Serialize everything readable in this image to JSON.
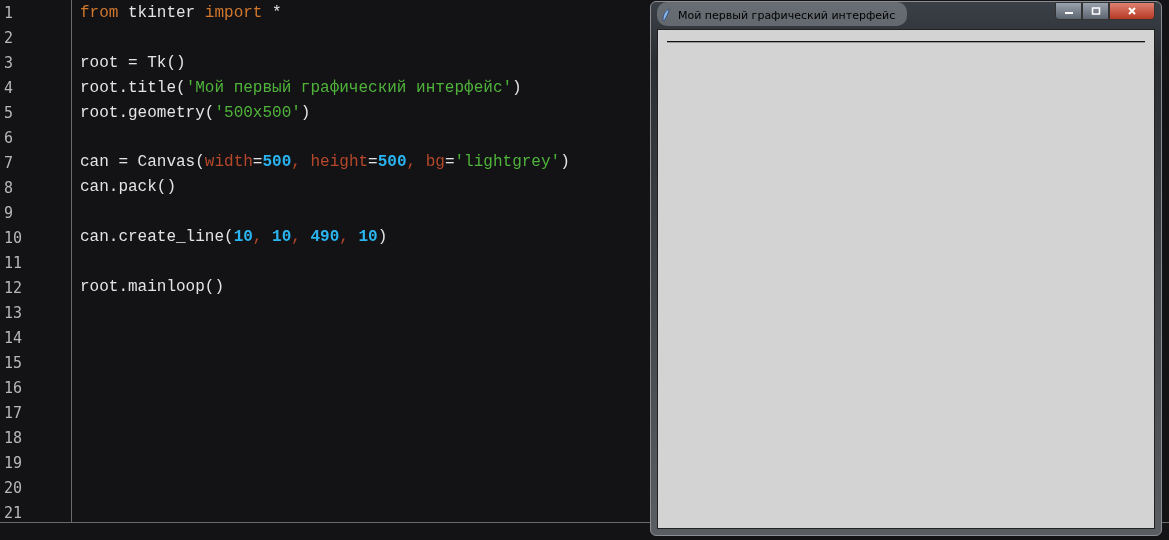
{
  "editor": {
    "lines": [
      {
        "number": "1",
        "tokens": [
          {
            "kind": "keyword",
            "text": "from"
          },
          {
            "kind": "plain",
            "text": " tkinter "
          },
          {
            "kind": "keyword",
            "text": "import"
          },
          {
            "kind": "plain",
            "text": " *"
          }
        ]
      },
      {
        "number": "2"
      },
      {
        "number": "3",
        "tokens": [
          {
            "kind": "plain",
            "text": "root = Tk()"
          }
        ]
      },
      {
        "number": "4",
        "tokens": [
          {
            "kind": "plain",
            "text": "root.title("
          },
          {
            "kind": "string",
            "text": "'Мой первый графический интерфейс'"
          },
          {
            "kind": "plain",
            "text": ")"
          }
        ]
      },
      {
        "number": "5",
        "tokens": [
          {
            "kind": "plain",
            "text": "root.geometry("
          },
          {
            "kind": "string",
            "text": "'500x500'"
          },
          {
            "kind": "plain",
            "text": ")"
          }
        ]
      },
      {
        "number": "6"
      },
      {
        "number": "7",
        "tokens": [
          {
            "kind": "plain",
            "text": "can = Canvas("
          },
          {
            "kind": "param",
            "text": "width"
          },
          {
            "kind": "plain",
            "text": "="
          },
          {
            "kind": "number",
            "text": "500"
          },
          {
            "kind": "param",
            "text": ", height"
          },
          {
            "kind": "plain",
            "text": "="
          },
          {
            "kind": "number",
            "text": "500"
          },
          {
            "kind": "param",
            "text": ", bg"
          },
          {
            "kind": "plain",
            "text": "="
          },
          {
            "kind": "string",
            "text": "'lightgrey'"
          },
          {
            "kind": "plain",
            "text": ")"
          }
        ]
      },
      {
        "number": "8",
        "tokens": [
          {
            "kind": "plain",
            "text": "can.pack()"
          }
        ]
      },
      {
        "number": "9"
      },
      {
        "number": "10",
        "tokens": [
          {
            "kind": "plain",
            "text": "can.create_line("
          },
          {
            "kind": "number",
            "text": "10"
          },
          {
            "kind": "param",
            "text": ", "
          },
          {
            "kind": "number",
            "text": "10"
          },
          {
            "kind": "param",
            "text": ", "
          },
          {
            "kind": "number",
            "text": "490"
          },
          {
            "kind": "param",
            "text": ", "
          },
          {
            "kind": "number",
            "text": "10"
          },
          {
            "kind": "plain",
            "text": ")"
          }
        ]
      },
      {
        "number": "11"
      },
      {
        "number": "12",
        "tokens": [
          {
            "kind": "plain",
            "text": "root.mainloop()"
          }
        ]
      },
      {
        "number": "13"
      },
      {
        "number": "14"
      },
      {
        "number": "15"
      },
      {
        "number": "16"
      },
      {
        "number": "17"
      },
      {
        "number": "18"
      },
      {
        "number": "19"
      },
      {
        "number": "20"
      },
      {
        "number": "21"
      }
    ]
  },
  "window": {
    "title": "Мой первый графический интерфейс"
  }
}
